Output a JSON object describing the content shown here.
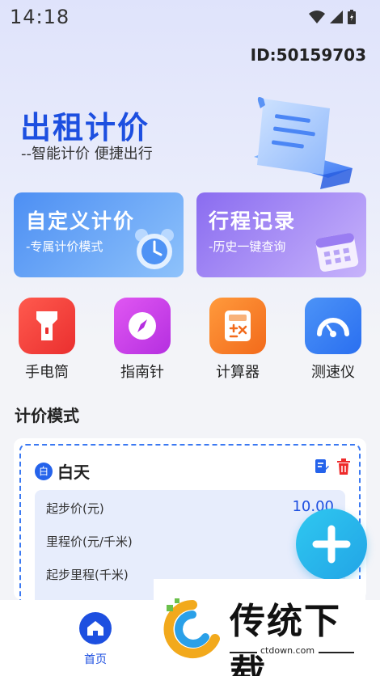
{
  "status_bar": {
    "time": "14:18"
  },
  "header": {
    "user_id": "ID:50159703"
  },
  "hero": {
    "title": "出租计价",
    "subtitle": "--智能计价 便捷出行"
  },
  "cards": [
    {
      "title": "自定义计价",
      "subtitle": "-专属计价模式",
      "icon": "alarm-clock-icon"
    },
    {
      "title": "行程记录",
      "subtitle": "-历史一键查询",
      "icon": "calendar-icon"
    }
  ],
  "tools": [
    {
      "label": "手电筒",
      "icon": "flashlight-icon",
      "color": "#f23b3b"
    },
    {
      "label": "指南针",
      "icon": "compass-icon",
      "color": "#c43ae8"
    },
    {
      "label": "计算器",
      "icon": "calculator-icon",
      "color": "#f56a20"
    },
    {
      "label": "测速仪",
      "icon": "speedometer-icon",
      "color": "#2f7cf0"
    }
  ],
  "pricing": {
    "section_title": "计价模式",
    "mode": {
      "badge": "白",
      "name": "白天",
      "rows": [
        {
          "label": "起步价(元)",
          "value": "10.00"
        },
        {
          "label": "里程价(元/千米)",
          "value": ""
        },
        {
          "label": "起步里程(千米)",
          "value": ""
        }
      ]
    }
  },
  "nav": {
    "home_label": "首页"
  },
  "watermark": {
    "text": "传统下载",
    "url": "ctdown.com"
  },
  "colors": {
    "accent": "#1d4fe0",
    "fab": "#22a4e6"
  }
}
